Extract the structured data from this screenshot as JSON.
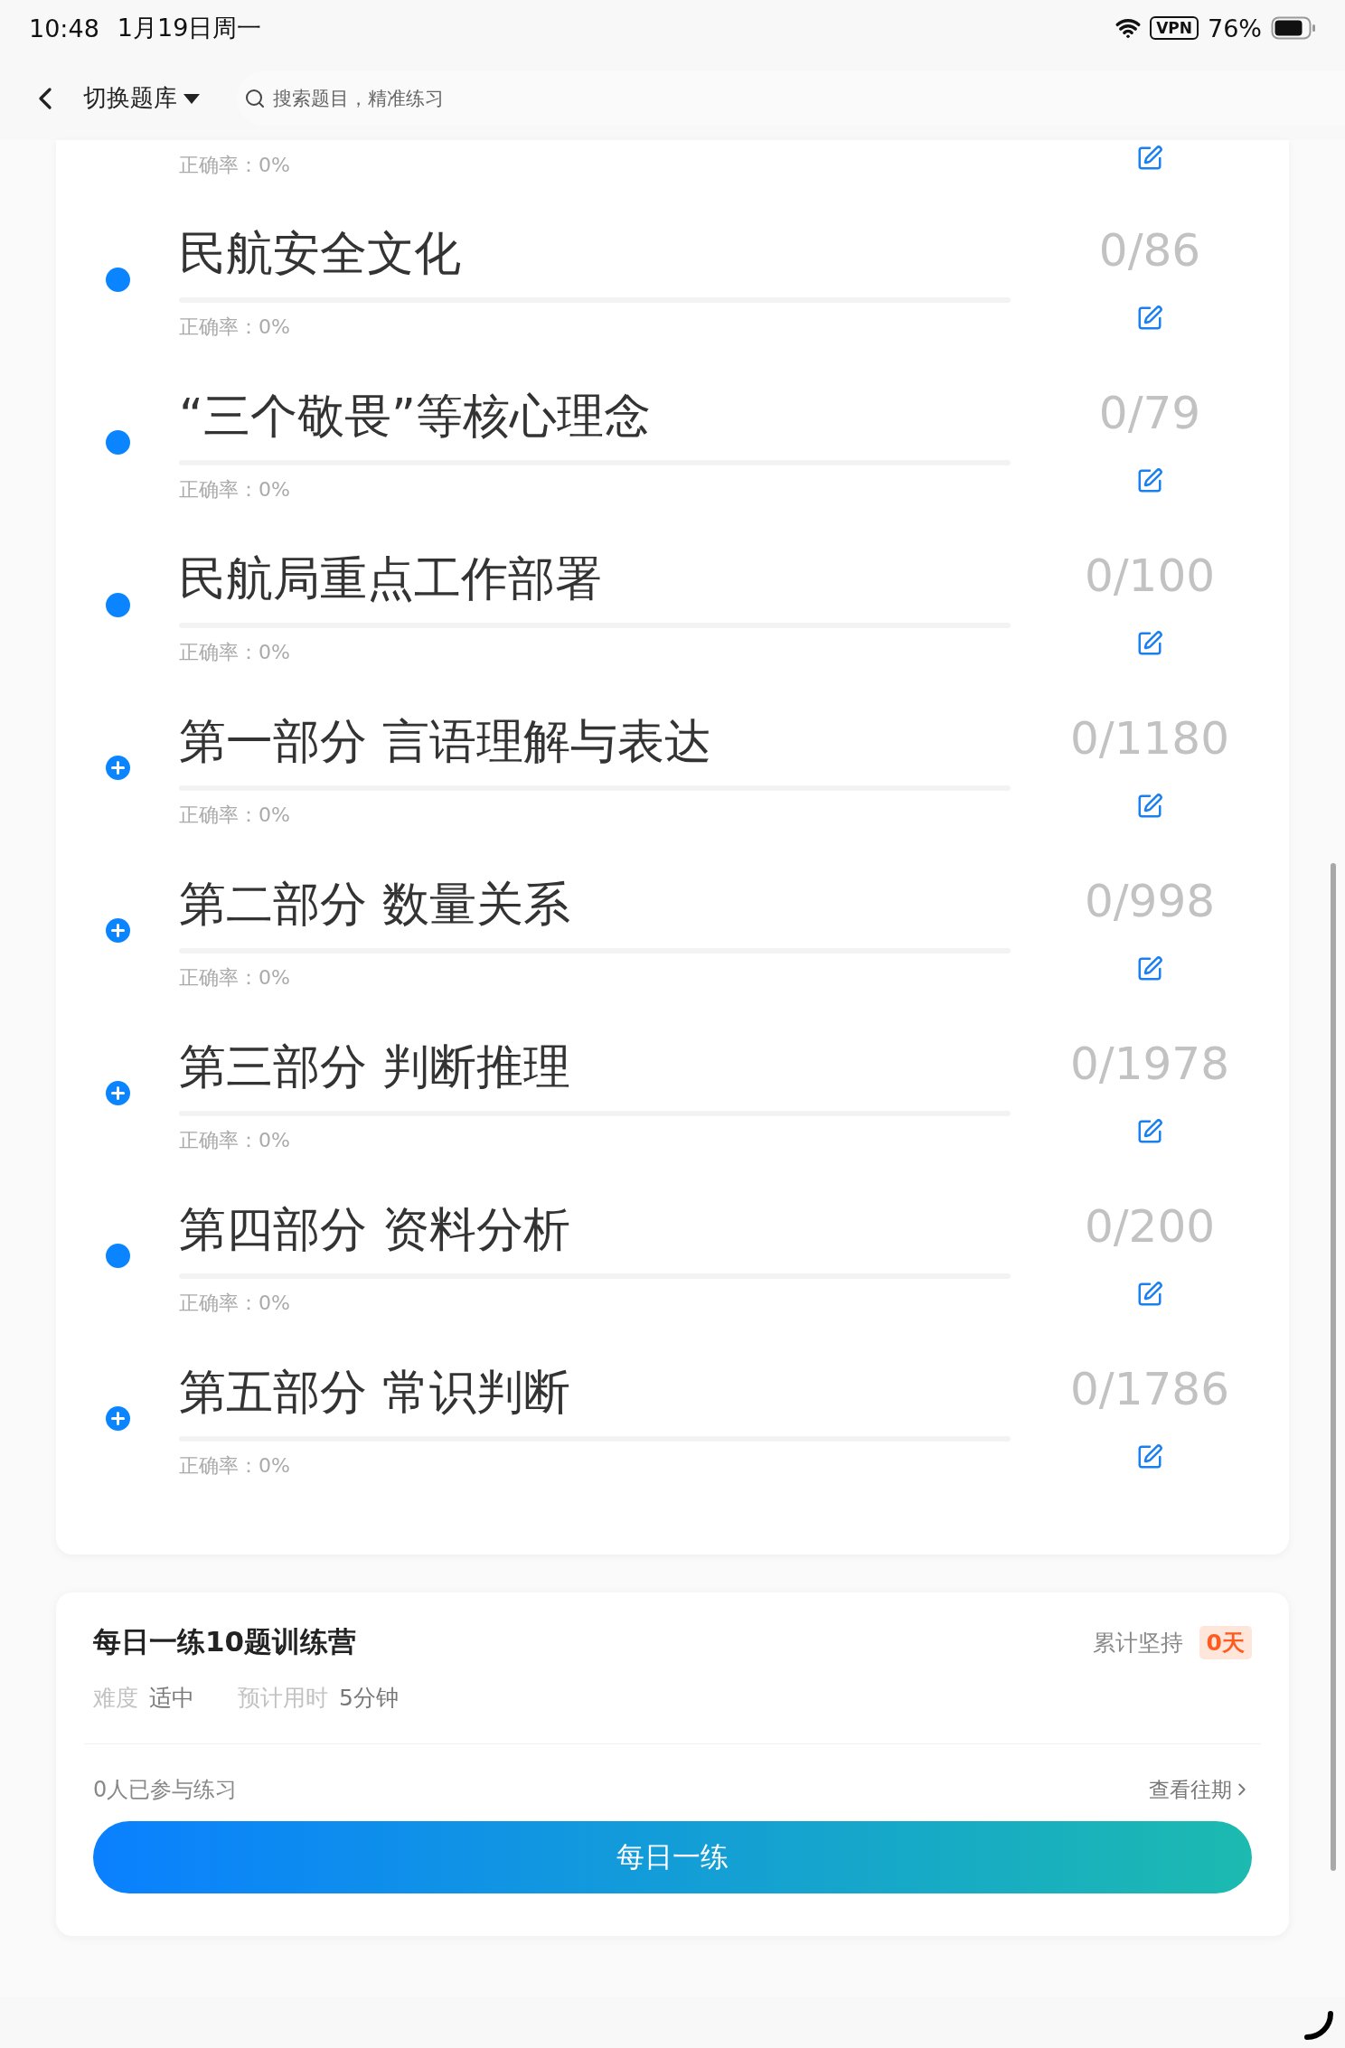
{
  "status_bar": {
    "time": "10:48",
    "date": "1月19日周一",
    "vpn": "VPN",
    "battery": "76%"
  },
  "nav": {
    "bank_switch": "切换题库",
    "search": {
      "placeholder": "搜索题目，精准练习"
    }
  },
  "partial_row": {
    "accuracy": "正确率：0%"
  },
  "rows": [
    {
      "kind": "dot",
      "title": "民航安全文化",
      "count": "0/86",
      "accuracy": "正确率：0%"
    },
    {
      "kind": "dot",
      "title": "“三个敬畏”等核心理念",
      "count": "0/79",
      "accuracy": "正确率：0%"
    },
    {
      "kind": "dot",
      "title": "民航局重点工作部署",
      "count": "0/100",
      "accuracy": "正确率：0%"
    },
    {
      "kind": "expand",
      "title": "第一部分 言语理解与表达",
      "count": "0/1180",
      "accuracy": "正确率：0%"
    },
    {
      "kind": "expand",
      "title": "第二部分 数量关系",
      "count": "0/998",
      "accuracy": "正确率：0%"
    },
    {
      "kind": "expand",
      "title": "第三部分 判断推理",
      "count": "0/1978",
      "accuracy": "正确率：0%"
    },
    {
      "kind": "dot",
      "title": "第四部分 资料分析",
      "count": "0/200",
      "accuracy": "正确率：0%"
    },
    {
      "kind": "expand",
      "title": "第五部分 常识判断",
      "count": "0/1786",
      "accuracy": "正确率：0%"
    }
  ],
  "camp": {
    "title": "每日一练10题训练营",
    "streak_label": "累计坚持",
    "streak": "0天",
    "difficulty_label": "难度",
    "difficulty": "适中",
    "time_label": "预计用时",
    "time": "5分钟",
    "participants": "0人已参与练习",
    "history_link": "查看往期",
    "button": "每日一练"
  }
}
